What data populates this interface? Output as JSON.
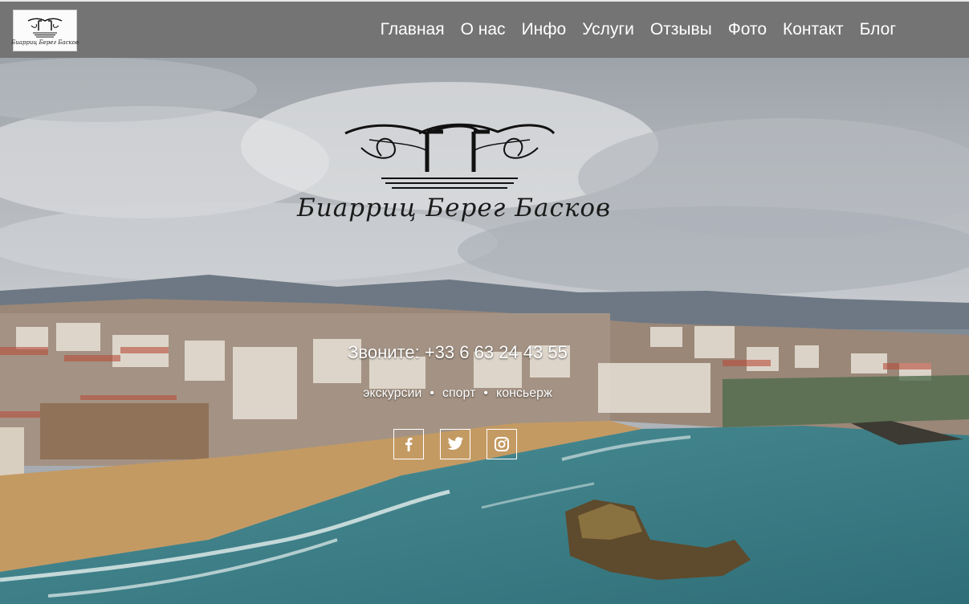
{
  "header": {
    "logo_text": "Биарриц Берег Басков",
    "nav": [
      "Главная",
      "О нас",
      "Инфо",
      "Услуги",
      "Отзывы",
      "Фото",
      "Контакт",
      "Блог"
    ]
  },
  "hero": {
    "brand_text": "Биарриц Берег Басков",
    "phone": "Звоните: +33 6 63 24 43 55",
    "tags": [
      "экскурсии",
      "спорт",
      "консьерж"
    ],
    "tag_separator": "•",
    "social": [
      "facebook-icon",
      "twitter-icon",
      "instagram-icon"
    ]
  },
  "colors": {
    "header_bg": "#747475",
    "nav_text": "#ffffff",
    "sea": "#3f7f84",
    "sand": "#c49a63"
  }
}
